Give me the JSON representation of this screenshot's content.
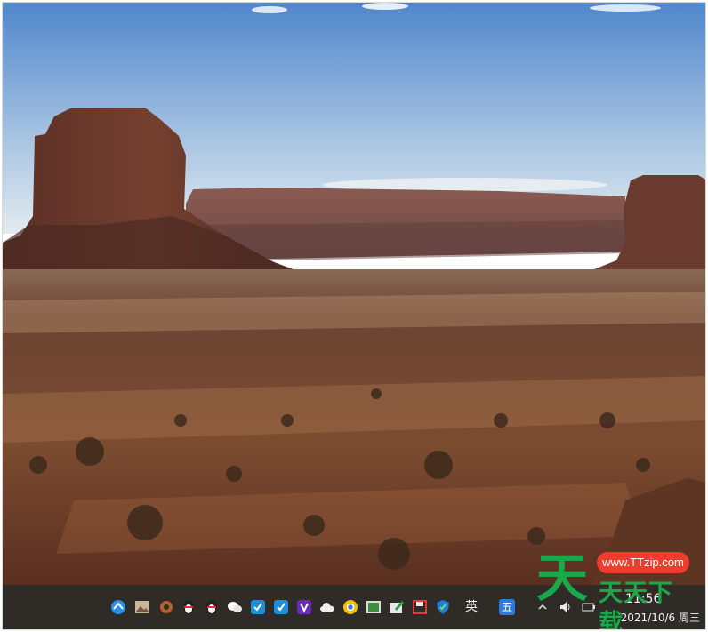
{
  "wallpaper": {
    "sky_top": "#5e8fcf",
    "sky_bottom": "#dfe8f0",
    "rock": "#6a3a2c",
    "desert": "#7a4a30"
  },
  "taskbar": {
    "background": "#2f2b27",
    "icons": [
      "browser-icon",
      "image-viewer-icon",
      "settings-gear-icon",
      "qq-penguin-icon",
      "qq-penguin-icon",
      "wechat-icon",
      "app-green-icon",
      "app-green-icon",
      "purple-v-icon",
      "cloud-icon",
      "chrome-icon",
      "photo-icon",
      "edit-tool-icon",
      "save-disk-icon",
      "security-shield-icon"
    ],
    "ime_lang": "英",
    "ime_mode": "五",
    "time": "11:56",
    "date": "2021/10/6 周三"
  },
  "watermark": {
    "big_char": "天",
    "url": "www.TTzip.com",
    "brand": "天天下载",
    "color": "#19a94a",
    "pill_color": "#ee3d2f"
  }
}
